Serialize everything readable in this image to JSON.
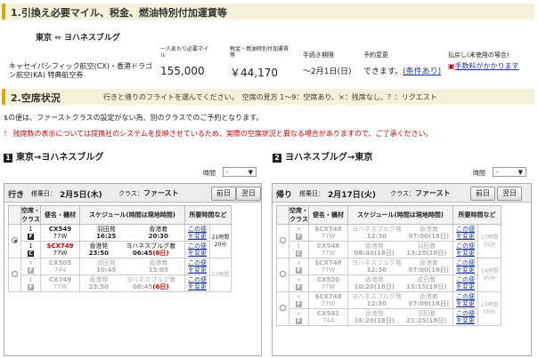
{
  "section1": {
    "title": "1.引換え必要マイル、税金、燃油特別付加運賃等",
    "route_from": "東京",
    "route_arrow": "⇔",
    "route_to": "ヨハネスブルグ",
    "col_miles": "一人あたり必要マイル",
    "col_tax": "税金・燃油特別付加運賃等",
    "col_deadline": "手続き期限",
    "col_booking": "予約変更",
    "col_refund": "払戻し(未使用の場合)",
    "ticket_type": "キャセイパシフィック航空(CX)・香港ドラゴン航空(KA) 特典航空券",
    "miles": "155,000",
    "tax": "￥44,170",
    "deadline": "～2月1日(日)",
    "booking": "できます。",
    "booking_link": "(条件あり)",
    "refund_link": "手数料がかかります"
  },
  "section2": {
    "title": "2.空席状況",
    "note": "行きと帰りのフライトを選んでください。　空席の見方 1～9：空席あり、×：残席なし、？：リクエスト",
    "first_note": "$の便は、ファーストクラスの設定がない為、別のクラスでのご予約となります。",
    "warning": "！ 残席数の表示については提携社のシステムを反映させているため、実際の空席状況と異なる場合がありますので、ご了承ください。"
  },
  "outbound": {
    "heading": "東京→ヨハネスブルグ",
    "time_label": "時間",
    "time_value": "-",
    "dir": "行き",
    "date_label": "搭乗日：",
    "date": "2月5日(木)",
    "class_label": "クラス：",
    "class": "ファースト",
    "prev": "前日",
    "next": "翌日",
    "headers": [
      "空席・クラス",
      "便名・機材",
      "スケジュール(時間は現地時間)",
      "所要時間など"
    ],
    "change": "この便を変更",
    "options": [
      {
        "selected": true,
        "enabled": true,
        "total": "21時間20分",
        "legs": [
          {
            "seat": "1",
            "cls": "F",
            "flight": "CX549",
            "aircraft": "77W",
            "dep_place": "羽田発",
            "dep_time": "16:25",
            "arr_place": "香港着",
            "arr_time": "20:30",
            "arr_day": ""
          },
          {
            "seat": "1",
            "cls": "C",
            "flight": "$CX749",
            "aircraft": "77W",
            "dep_place": "香港発",
            "dep_time": "23:50",
            "arr_place": "ヨハネスブルグ着",
            "arr_time": "06:45",
            "arr_day": "(6日)"
          }
        ]
      },
      {
        "selected": false,
        "enabled": false,
        "total": "27時間",
        "legs": [
          {
            "seat": "×",
            "cls": "F",
            "flight": "CX505",
            "aircraft": "744",
            "dep_place": "成田発",
            "dep_time": "10:45",
            "arr_place": "香港着",
            "arr_time": "15:05",
            "arr_day": ""
          },
          {
            "seat": "1",
            "cls": "F",
            "flight": "CX749",
            "aircraft": "77W",
            "dep_place": "香港発",
            "dep_time": "23:50",
            "arr_place": "ヨハネスブルグ着",
            "arr_time": "06:45",
            "arr_day": "(6日)"
          }
        ]
      }
    ]
  },
  "inbound": {
    "heading": "ヨハネスブルグ→東京",
    "time_label": "時間",
    "time_value": "-",
    "dir": "帰り",
    "date_label": "搭乗日：",
    "date": "2月17日(火)",
    "class_label": "クラス：",
    "class": "ファースト",
    "prev": "前日",
    "next": "翌日",
    "headers": [
      "空席・クラス",
      "便名・機材",
      "スケジュール(時間は現地時間)",
      "所要時間など"
    ],
    "change": "この便を変更",
    "options": [
      {
        "total": "17時間55分",
        "legs": [
          {
            "seat": "×",
            "cls": "F",
            "flight": "$CX748",
            "aircraft": "77W",
            "dep_place": "ヨハネスブルグ発",
            "dep_time": "12:30",
            "arr_place": "香港着",
            "arr_time": "07:00(18日)"
          },
          {
            "seat": "1",
            "cls": "C",
            "flight": "CX548",
            "aircraft": "77W",
            "dep_place": "香港発",
            "dep_time": "08:40(18日)",
            "arr_place": "羽田着",
            "arr_time": "13:25(18日)"
          }
        ]
      },
      {
        "total": "19時間45分",
        "legs": [
          {
            "seat": "×",
            "cls": "F",
            "flight": "$CX748",
            "aircraft": "77W",
            "dep_place": "ヨハネスブルグ発",
            "dep_time": "12:30",
            "arr_place": "香港着",
            "arr_time": "07:00(18日)"
          },
          {
            "seat": "×",
            "cls": "F",
            "flight": "CX520",
            "aircraft": "77W",
            "dep_place": "香港発",
            "dep_time": "10:20(18日)",
            "arr_place": "成田着",
            "arr_time": "15:15(18日)"
          }
        ]
      },
      {
        "total": "25時間55分",
        "legs": [
          {
            "seat": "×",
            "cls": "F",
            "flight": "$CX748",
            "aircraft": "77W",
            "dep_place": "ヨハネスブルグ発",
            "dep_time": "12:30",
            "arr_place": "香港着",
            "arr_time": "07:00(18日)"
          },
          {
            "seat": "×",
            "cls": "F",
            "flight": "CX542",
            "aircraft": "744",
            "dep_place": "香港発",
            "dep_time": "16:20(18日)",
            "arr_place": "羽田着",
            "arr_time": "21:25(18日)"
          }
        ]
      }
    ]
  }
}
